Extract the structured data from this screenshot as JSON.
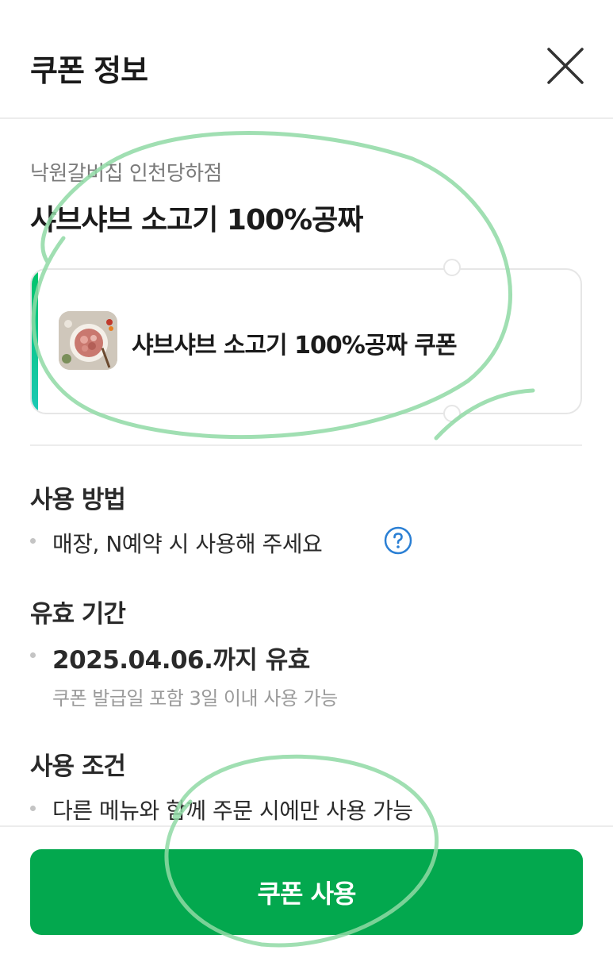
{
  "header": {
    "title": "쿠폰 정보",
    "close_icon": "close-icon"
  },
  "store": {
    "name": "낙원갈비집 인천당하점"
  },
  "coupon": {
    "title": "샤브샤브 소고기 100%공짜",
    "card_name": "샤브샤브 소고기 100%공짜 쿠폰",
    "accent_colors": [
      "#00c46a",
      "#1cc9b5"
    ]
  },
  "usage": {
    "title": "사용 방법",
    "text": "매장, N예약 시 사용해 주세요",
    "help_icon": "question-circle-icon"
  },
  "validity": {
    "title": "유효 기간",
    "date": "2025.04.06.까지 유효",
    "note": "쿠폰 발급일 포함 3일 이내 사용 가능"
  },
  "conditions": {
    "title": "사용 조건",
    "text": "다른 메뉴와 함께 주문 시에만 사용 가능"
  },
  "action": {
    "button_label": "쿠폰 사용",
    "button_color": "#03a84e"
  }
}
